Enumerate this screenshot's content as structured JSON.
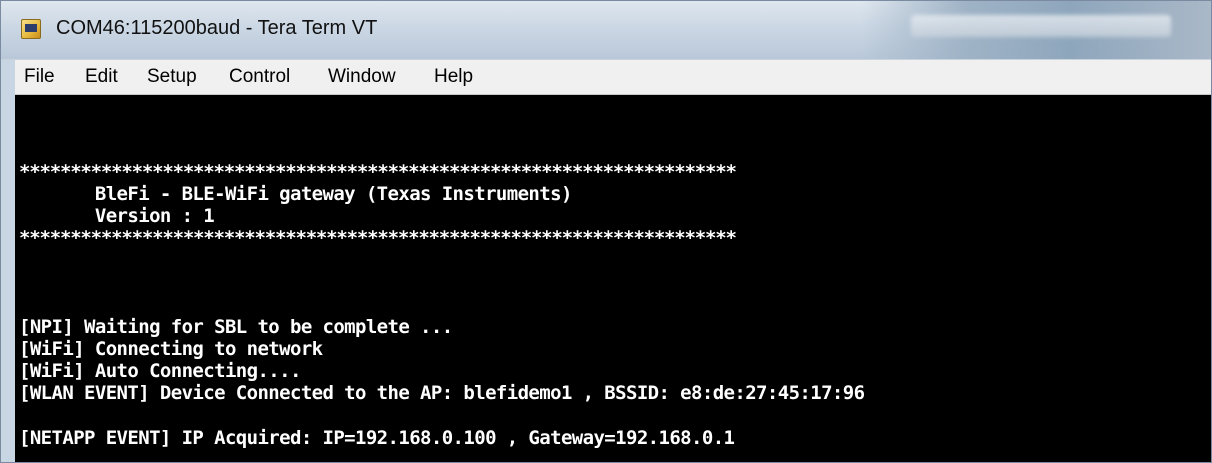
{
  "window": {
    "title": "COM46:115200baud - Tera Term VT",
    "icon": "teraterm-app-icon"
  },
  "menu": {
    "items": [
      {
        "label": "File"
      },
      {
        "label": "Edit"
      },
      {
        "label": "Setup"
      },
      {
        "label": "Control"
      },
      {
        "label": "Window"
      },
      {
        "label": "Help"
      }
    ]
  },
  "terminal": {
    "background": "#000000",
    "foreground": "#ffffff",
    "lines": [
      "**********************************************************************",
      "       BleFi - BLE-WiFi gateway (Texas Instruments)",
      "       Version : 1",
      "**********************************************************************",
      "[NPI] Waiting for SBL to be complete ...",
      "[WiFi] Connecting to network",
      "[WiFi] Auto Connecting....",
      "[WLAN EVENT] Device Connected to the AP: blefidemo1 , BSSID: e8:de:27:45:17:96",
      "[NETAPP EVENT] IP Acquired: IP=192.168.0.100 , Gateway=192.168.0.1"
    ]
  }
}
